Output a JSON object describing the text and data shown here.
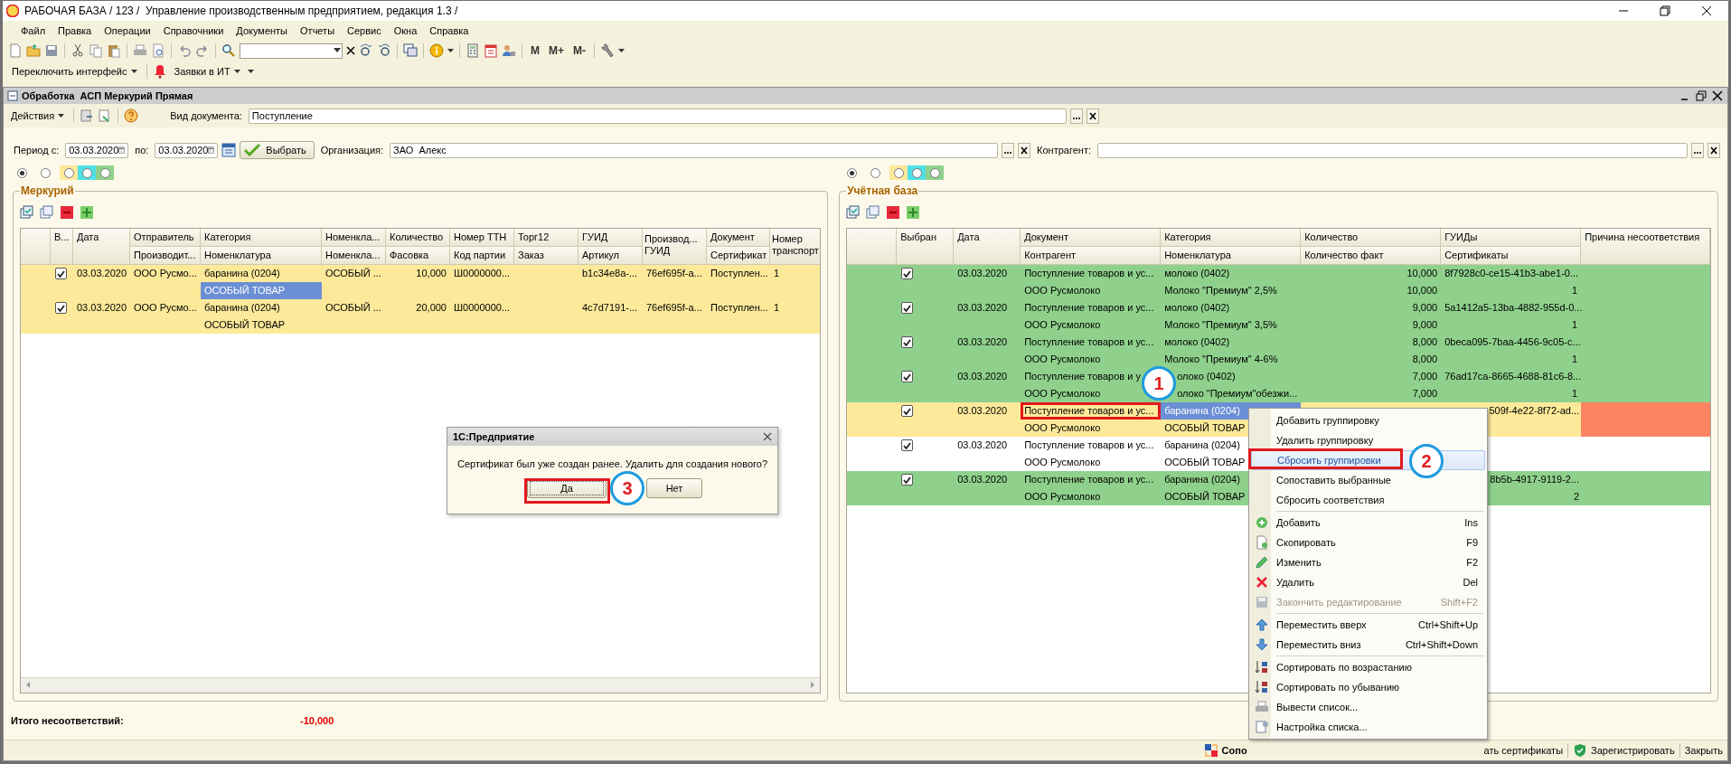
{
  "window": {
    "title": "РАБОЧАЯ БАЗА / 123 /  Управление производственным предприятием, редакция 1.3 /"
  },
  "menu": [
    "Файл",
    "Правка",
    "Операции",
    "Справочники",
    "Документы",
    "Отчеты",
    "Сервис",
    "Окна",
    "Справка"
  ],
  "toolbar": {
    "memory_buttons": [
      "M",
      "M+",
      "M-"
    ]
  },
  "toolbar2": [
    "Переключить интерфейс",
    "Заявки в ИТ"
  ],
  "form": {
    "title": "Обработка  АСП Меркурий Прямая",
    "actions": "Действия",
    "doc_type": {
      "label": "Вид документа:",
      "value": "Поступление"
    },
    "period": {
      "from_label": "Период с:",
      "from": "03.03.2020",
      "to_label": "по:",
      "to": "03.03.2020",
      "select": "Выбрать",
      "org_label": "Организация:",
      "org": "ЗАО  Алекс",
      "counterparty_label": "Контрагент:"
    }
  },
  "panels": [
    {
      "title": "Меркурий",
      "kind": "scrolled",
      "filters": [
        {
          "selected": true
        },
        {
          "selected": false
        },
        {
          "color": "#fde99a",
          "selected": false
        },
        {
          "color": "#4fe0e6",
          "selected": false
        },
        {
          "color": "#8fd18c",
          "selected": false
        }
      ],
      "table": {
        "columns": [
          {
            "kind": "blank"
          },
          {
            "kind": "check",
            "top": "В..."
          },
          {
            "kind": "text",
            "top": "Дата"
          },
          {
            "kind": "text",
            "top": "Отправитель",
            "bottom": "Производит...",
            "stacked": false
          },
          {
            "kind": "text",
            "top": "Категория",
            "bottom": "Номенклатура",
            "stacked": false
          },
          {
            "kind": "text",
            "top": "Номенкла...",
            "bottom": "Номенкла...",
            "stacked": false
          },
          {
            "kind": "number",
            "top": "Количество",
            "bottom": "Фасовка",
            "stacked": false
          },
          {
            "kind": "text",
            "top": "Номер ТТН",
            "bottom": "Код партии",
            "stacked": false
          },
          {
            "kind": "text",
            "top": "Торг12",
            "bottom": "Заказ",
            "stacked": false
          },
          {
            "kind": "text",
            "top": "ГУИД",
            "bottom": "Артикул",
            "stacked": false
          },
          {
            "kind": "text",
            "top": "Производ...",
            "bottom": "ГУИД",
            "stacked": true
          },
          {
            "kind": "text",
            "top": "Документ",
            "bottom": "Сертификат",
            "stacked": false
          },
          {
            "kind": "text",
            "top": "Номер",
            "bottom": "транспорт",
            "stacked": true
          }
        ],
        "rows": [
          {
            "color": "#fde99a",
            "checked": true,
            "cells": [
              [],
              [],
              [
                "03.03.2020"
              ],
              [
                "ООО Русмо..."
              ],
              {
                "lines": [
                  "баранина (0204)",
                  "ОСОБЫЙ ТОВАР"
                ],
                "selected_top": false,
                "selected_bottom": true
              },
              [
                "ОСОБЫЙ ..."
              ],
              [
                "10,000"
              ],
              [
                "Ш0000000..."
              ],
              [],
              [
                "b1c34e8a-..."
              ],
              [
                "76ef695f-a..."
              ],
              [
                "Поступлен..."
              ],
              [
                "1"
              ]
            ]
          },
          {
            "color": "#fde99a",
            "checked": true,
            "cells": [
              [],
              [],
              [
                "03.03.2020"
              ],
              [
                "ООО Русмо..."
              ],
              [
                "баранина (0204)",
                "ОСОБЫЙ ТОВАР"
              ],
              [
                "ОСОБЫЙ ..."
              ],
              [
                "20,000"
              ],
              [
                "Ш0000000..."
              ],
              [],
              [
                "4c7d7191-..."
              ],
              [
                "76ef695f-a..."
              ],
              [
                "Поступлен..."
              ],
              [
                "1"
              ]
            ]
          }
        ]
      }
    },
    {
      "title": "Учётная база",
      "kind": "plain",
      "filters": [
        {
          "selected": true
        },
        {
          "selected": false
        },
        {
          "color": "#fde99a",
          "selected": false
        },
        {
          "color": "#4fe0e6",
          "selected": false
        },
        {
          "color": "#8fd18c",
          "selected": false
        }
      ],
      "table": {
        "columns": [
          {
            "kind": "blank"
          },
          {
            "kind": "check",
            "top": "Выбран"
          },
          {
            "kind": "text",
            "top": "Дата"
          },
          {
            "kind": "text",
            "top": "Документ",
            "bottom": "Контрагент",
            "stacked": false
          },
          {
            "kind": "text",
            "top": "Категория",
            "bottom": "Номенклатура",
            "stacked": false
          },
          {
            "kind": "number",
            "top": "Количество",
            "bottom": "Количество факт",
            "stacked": false
          },
          {
            "kind": "guid",
            "top": "ГУИДы",
            "bottom": "Сертификаты",
            "stacked": false
          },
          {
            "kind": "reason",
            "top": "Причина несоответствия"
          }
        ],
        "rows": [
          {
            "color": "#8fd18c",
            "checked": true,
            "cells": [
              [],
              [],
              [
                "03.03.2020"
              ],
              [
                "Поступление товаров и ус...",
                "ООО Русмолоко"
              ],
              [
                "молоко (0402)",
                "Молоко \"Премиум\" 2,5%"
              ],
              [
                "10,000",
                "10,000"
              ],
              [
                "8f7928c0-ce15-41b3-abe1-0...",
                "1"
              ],
              []
            ]
          },
          {
            "color": "#8fd18c",
            "checked": true,
            "cells": [
              [],
              [],
              [
                "03.03.2020"
              ],
              [
                "Поступление товаров и ус...",
                "ООО Русмолоко"
              ],
              [
                "молоко (0402)",
                "Молоко \"Премиум\" 3,5%"
              ],
              [
                "9,000",
                "9,000"
              ],
              [
                "5a1412a5-13ba-4882-955d-0...",
                "1"
              ],
              []
            ]
          },
          {
            "color": "#8fd18c",
            "checked": true,
            "cells": [
              [],
              [],
              [
                "03.03.2020"
              ],
              [
                "Поступление товаров и ус...",
                "ООО Русмолоко"
              ],
              [
                "молоко (0402)",
                "Молоко \"Премиум\" 4-6%"
              ],
              [
                "8,000",
                "8,000"
              ],
              [
                "0beca095-7baa-4456-9c05-c...",
                "1"
              ],
              []
            ]
          },
          {
            "color": "#8fd18c",
            "checked": true,
            "cells": [
              [],
              [],
              [
                "03.03.2020"
              ],
              [
                "Поступление товаров и у",
                "ООО Русмолоко"
              ],
              {
                "lines": [
                  "олоко (0402)",
                  "олоко \"Премиум\"обезжи..."
                ],
                "kind": "covered"
              },
              [
                "7,000",
                "7,000"
              ],
              [
                "76ad17ca-8665-4688-81c6-8...",
                "1"
              ],
              []
            ]
          },
          {
            "color": "#fde99a",
            "checked": true,
            "cells": [
              [],
              [],
              [
                "03.03.2020"
              ],
              {
                "lines": [
                  "Поступление товаров и ус...",
                  "ООО Русмолоко"
                ],
                "outlined_top": true,
                "outlined_bottom": false
              },
              {
                "lines": [
                  "баранина (0204)",
                  "ОСОБЫЙ ТОВАР"
                ],
                "selected_top": true,
                "selected_bottom": false
              },
              [],
              {
                "lines": [
                  "509f-4e22-8f72-ad..."
                ],
                "kind": "clipped"
              },
              {
                "color": "#fc8462"
              }
            ]
          },
          {
            "color": "#ffffff",
            "checked": true,
            "cells": [
              [],
              [],
              [
                "03.03.2020"
              ],
              [
                "Поступление товаров и ус...",
                "ООО Русмолоко"
              ],
              [
                "баранина (0204)",
                "ОСОБЫЙ ТОВАР"
              ],
              [],
              [],
              []
            ]
          },
          {
            "color": "#8fd18c",
            "checked": true,
            "cells": [
              [],
              [],
              [
                "03.03.2020"
              ],
              [
                "Поступление товаров и ус...",
                "ООО Русмолоко"
              ],
              [
                "баранина (0204)",
                "ОСОБЫЙ ТОВАР"
              ],
              [],
              {
                "lines": [
                  "8b5b-4917-9119-2...",
                  "2"
                ],
                "kind": "clipped"
              },
              []
            ]
          }
        ]
      }
    }
  ],
  "totals": {
    "label": "Итого несоответствий:",
    "value": "-10,000"
  },
  "status_bar": [
    {
      "label": "Сопо",
      "kind": "match"
    },
    {
      "label": "ать сертификаты",
      "kind": "plain"
    },
    {
      "label": "Зарегистрировать",
      "kind": "register"
    },
    {
      "label": "Закрыть",
      "kind": "plain"
    }
  ],
  "context_menu": {
    "items": [
      {
        "label": "Добавить группировку",
        "kind": "plain",
        "selected": false,
        "disabled": false
      },
      {
        "label": "Удалить группировку",
        "kind": "plain",
        "selected": false,
        "disabled": false
      },
      {
        "label": "Сбросить группировки",
        "kind": "plain",
        "selected": true,
        "disabled": false
      },
      {
        "label": "Сопоставить выбранные",
        "kind": "plain",
        "selected": false,
        "disabled": false
      },
      {
        "label": "Сбросить соответствия",
        "kind": "plain",
        "selected": false,
        "disabled": false
      },
      {
        "kind": "separator"
      },
      {
        "label": "Добавить",
        "shortcut": "Ins",
        "kind": "add",
        "selected": false,
        "disabled": false
      },
      {
        "label": "Скопировать",
        "shortcut": "F9",
        "kind": "copy",
        "selected": false,
        "disabled": false
      },
      {
        "label": "Изменить",
        "shortcut": "F2",
        "kind": "edit",
        "selected": false,
        "disabled": false
      },
      {
        "label": "Удалить",
        "shortcut": "Del",
        "kind": "delete",
        "selected": false,
        "disabled": false
      },
      {
        "label": "Закончить редактирование",
        "shortcut": "Shift+F2",
        "kind": "save",
        "selected": false,
        "disabled": true
      },
      {
        "kind": "separator"
      },
      {
        "label": "Переместить вверх",
        "shortcut": "Ctrl+Shift+Up",
        "kind": "up",
        "selected": false,
        "disabled": false
      },
      {
        "label": "Переместить вниз",
        "shortcut": "Ctrl+Shift+Down",
        "kind": "down",
        "selected": false,
        "disabled": false
      },
      {
        "kind": "separator"
      },
      {
        "label": "Сортировать по возрастанию",
        "kind": "sort-asc",
        "selected": false,
        "disabled": false
      },
      {
        "label": "Сортировать по убыванию",
        "kind": "sort-desc",
        "selected": false,
        "disabled": false
      },
      {
        "label": "Вывести список...",
        "kind": "print",
        "selected": false,
        "disabled": false
      },
      {
        "label": "Настройка списка...",
        "kind": "settings",
        "selected": false,
        "disabled": false
      }
    ]
  },
  "dialog": {
    "title": "1С:Предприятие",
    "message": "Сертификат был уже создан ранее. Удалить для создания нового?",
    "buttons": [
      {
        "label": "Да",
        "focused": true
      },
      {
        "label": "Нет",
        "focused": false
      }
    ]
  },
  "callouts": [
    {
      "number": "1"
    },
    {
      "number": "2"
    },
    {
      "number": "3"
    }
  ]
}
